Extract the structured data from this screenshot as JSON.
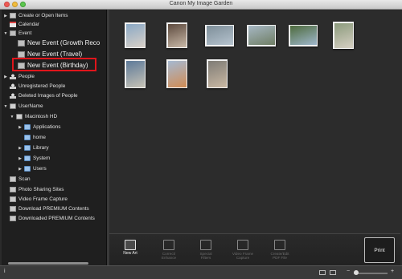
{
  "window": {
    "title": "Canon My Image Garden"
  },
  "sidebar": {
    "items": [
      {
        "label": "Create or Open Items",
        "arrow": "▶",
        "icon": "create-items-icon"
      },
      {
        "label": "Calendar",
        "arrow": "",
        "icon": "calendar-icon"
      },
      {
        "label": "Event",
        "arrow": "▼",
        "icon": "event-icon"
      },
      {
        "label": "New Event (Growth Reco",
        "arrow": "",
        "icon": "event-thumbnail-icon"
      },
      {
        "label": "New Event (Travel)",
        "arrow": "",
        "icon": "event-thumbnail-icon"
      },
      {
        "label": "New Event (Birthday)",
        "arrow": "",
        "icon": "event-thumbnail-icon"
      },
      {
        "label": "People",
        "arrow": "▶",
        "icon": "people-icon"
      },
      {
        "label": "Unregistered People",
        "arrow": "",
        "icon": "person-icon"
      },
      {
        "label": "Deleted Images of People",
        "arrow": "",
        "icon": "person-icon"
      },
      {
        "label": "UserName",
        "arrow": "▼",
        "icon": "computer-icon"
      },
      {
        "label": "Macintosh HD",
        "arrow": "▼",
        "icon": "drive-icon"
      },
      {
        "label": "Applications",
        "arrow": "▶",
        "icon": "folder-icon"
      },
      {
        "label": "home",
        "arrow": "",
        "icon": "folder-icon"
      },
      {
        "label": "Library",
        "arrow": "▶",
        "icon": "folder-icon"
      },
      {
        "label": "System",
        "arrow": "▶",
        "icon": "folder-icon"
      },
      {
        "label": "Users",
        "arrow": "▶",
        "icon": "folder-icon"
      },
      {
        "label": "Scan",
        "arrow": "",
        "icon": "scan-icon"
      },
      {
        "label": "Photo Sharing Sites",
        "arrow": "",
        "icon": "photo-sharing-icon"
      },
      {
        "label": "Video Frame Capture",
        "arrow": "",
        "icon": "video-frame-icon"
      },
      {
        "label": "Download PREMIUM Contents",
        "arrow": "",
        "icon": "download-icon"
      },
      {
        "label": "Downloaded PREMIUM Contents",
        "arrow": "",
        "icon": "downloaded-icon"
      }
    ],
    "selected": "New Event (Birthday)"
  },
  "toolbar": {
    "new_art": "New Art",
    "correct_enhance": "Correct/\nEnhance",
    "special_filters": "Special\nFilters",
    "video_frame_capture": "Video Frame\nCapture",
    "create_edit_pdf": "Create/Edit\nPDF File",
    "print": "Print"
  },
  "statusbar": {
    "info": "i",
    "zoom_minus": "−",
    "zoom_plus": "+"
  },
  "photos": [
    {
      "name": "photo-1",
      "colors": [
        "#8aa8c5",
        "#d9d1c8"
      ]
    },
    {
      "name": "photo-2",
      "colors": [
        "#5d4a3e",
        "#c9b9a8"
      ]
    },
    {
      "name": "photo-3",
      "colors": [
        "#7d8e99",
        "#b6c3ce"
      ]
    },
    {
      "name": "photo-4",
      "colors": [
        "#a7b8c5",
        "#6f7e64"
      ]
    },
    {
      "name": "photo-5",
      "colors": [
        "#4d6a3c",
        "#9fb7cc"
      ]
    },
    {
      "name": "photo-6",
      "colors": [
        "#8b9a7c",
        "#d6d0c3"
      ]
    },
    {
      "name": "photo-7",
      "colors": [
        "#5e7a99",
        "#c7c3b6"
      ]
    },
    {
      "name": "photo-8",
      "colors": [
        "#a5b9d2",
        "#d18c54"
      ]
    },
    {
      "name": "photo-9",
      "colors": [
        "#7f7c76",
        "#c9b8a3"
      ]
    },
    {
      "name": "photo-10",
      "colors": [
        "#84a4c8",
        "#d9b07d"
      ]
    }
  ],
  "colors": {
    "highlight": "#e0151b",
    "background": "#2b2b2b",
    "sidebar": "#1f1f1f"
  }
}
